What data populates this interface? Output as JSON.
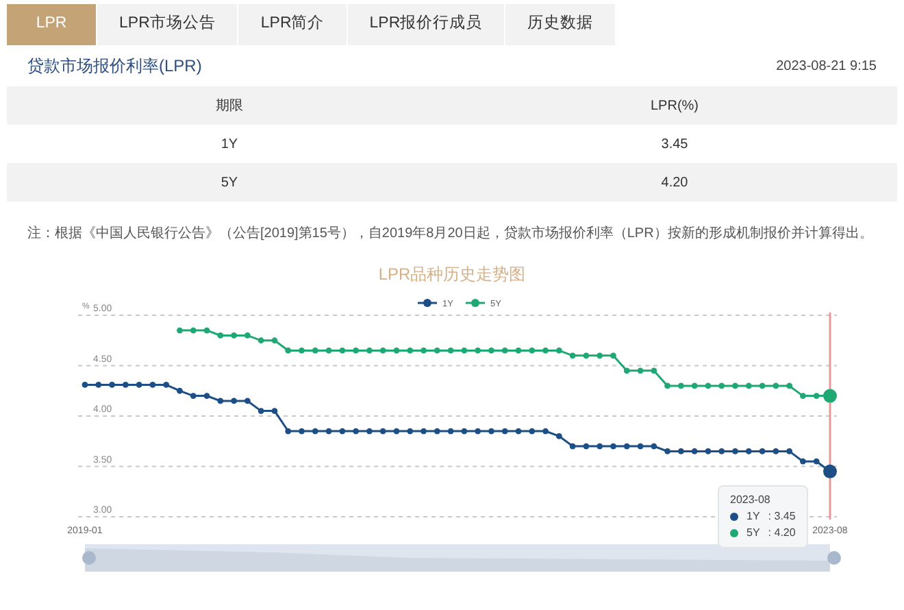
{
  "tabs": [
    {
      "label": "LPR",
      "selected": true
    },
    {
      "label": "LPR市场公告",
      "selected": false
    },
    {
      "label": "LPR简介",
      "selected": false
    },
    {
      "label": "LPR报价行成员",
      "selected": false
    },
    {
      "label": "历史数据",
      "selected": false
    }
  ],
  "heading": {
    "title": "贷款市场报价利率(LPR)",
    "timestamp": "2023-08-21 9:15"
  },
  "table": {
    "columns": [
      "期限",
      "LPR(%)"
    ],
    "rows": [
      [
        "1Y",
        "3.45"
      ],
      [
        "5Y",
        "4.20"
      ]
    ]
  },
  "note": "注：根据《中国人民银行公告》（公告[2019]第15号），自2019年8月20日起，贷款市场报价利率（LPR）按新的形成机制报价并计算得出。",
  "chart": {
    "chart_data": {
      "type": "line",
      "title": "LPR品种历史走势图",
      "ylabel": "%",
      "categories": [
        "2019-01",
        null,
        null,
        null,
        null,
        null,
        null,
        null,
        null,
        null,
        null,
        null,
        null,
        null,
        null,
        null,
        null,
        null,
        null,
        null,
        null,
        null,
        null,
        null,
        null,
        null,
        null,
        null,
        null,
        null,
        null,
        null,
        null,
        null,
        null,
        null,
        null,
        null,
        null,
        null,
        null,
        null,
        null,
        null,
        null,
        null,
        null,
        null,
        null,
        null,
        null,
        null,
        null,
        null,
        null,
        "2023-08"
      ],
      "grid": true,
      "legend": true,
      "series": [
        {
          "name": "1Y",
          "color": "#1d4e85",
          "marker": "circle",
          "values": [
            4.31,
            4.31,
            4.31,
            4.31,
            4.31,
            4.31,
            4.31,
            4.25,
            4.2,
            4.2,
            4.15,
            4.15,
            4.15,
            4.05,
            4.05,
            3.85,
            3.85,
            3.85,
            3.85,
            3.85,
            3.85,
            3.85,
            3.85,
            3.85,
            3.85,
            3.85,
            3.85,
            3.85,
            3.85,
            3.85,
            3.85,
            3.85,
            3.85,
            3.85,
            3.85,
            3.8,
            3.7,
            3.7,
            3.7,
            3.7,
            3.7,
            3.7,
            3.7,
            3.65,
            3.65,
            3.65,
            3.65,
            3.65,
            3.65,
            3.65,
            3.65,
            3.65,
            3.65,
            3.55,
            3.55,
            3.45
          ]
        },
        {
          "name": "5Y",
          "color": "#1fa774",
          "marker": "circle",
          "values": [
            null,
            null,
            null,
            null,
            null,
            null,
            null,
            4.85,
            4.85,
            4.85,
            4.8,
            4.8,
            4.8,
            4.75,
            4.75,
            4.65,
            4.65,
            4.65,
            4.65,
            4.65,
            4.65,
            4.65,
            4.65,
            4.65,
            4.65,
            4.65,
            4.65,
            4.65,
            4.65,
            4.65,
            4.65,
            4.65,
            4.65,
            4.65,
            4.65,
            4.65,
            4.6,
            4.6,
            4.6,
            4.6,
            4.45,
            4.45,
            4.45,
            4.3,
            4.3,
            4.3,
            4.3,
            4.3,
            4.3,
            4.3,
            4.3,
            4.3,
            4.3,
            4.2,
            4.2,
            4.2
          ]
        }
      ],
      "ylim": [
        3,
        5
      ],
      "yticks": [
        {
          "value": 3,
          "label": "3.00"
        },
        {
          "value": 3.5,
          "label": "3.50"
        },
        {
          "value": 4,
          "label": "4.00"
        },
        {
          "value": 4.5,
          "label": "4.50"
        },
        {
          "value": 5,
          "label": "5.00"
        }
      ]
    },
    "tooltip": {
      "title": "2023-08",
      "items": [
        {
          "name": "1Y",
          "value": ": 3.45",
          "color": "#1d4e85"
        },
        {
          "name": "5Y",
          "value": ": 4.20",
          "color": "#1fa774"
        }
      ]
    }
  }
}
